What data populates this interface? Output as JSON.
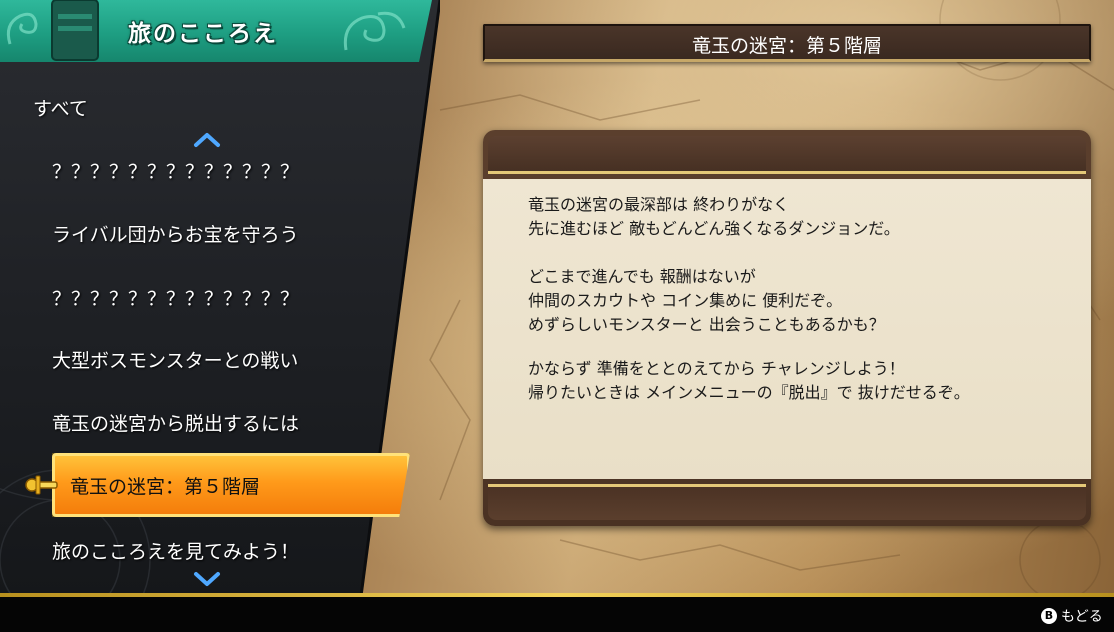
{
  "header": {
    "title": "旅のこころえ"
  },
  "menu": {
    "all_label": "すべて",
    "items": [
      "？？？？？？？？？？？？？",
      "ライバル団からお宝を守ろう",
      "？？？？？？？？？？？？？",
      "大型ボスモンスターとの戦い",
      "竜玉の迷宮から脱出するには",
      "竜玉の迷宮：第５階層",
      "旅のこころえを見てみよう！"
    ],
    "selected_index": 5
  },
  "content": {
    "title": "竜玉の迷宮：第５階層",
    "lines": [
      "竜玉の迷宮の最深部は 終わりがなく",
      "先に進むほど 敵もどんどん強くなるダンジョンだ。",
      "",
      "どこまで進んでも 報酬はないが",
      "仲間のスカウトや コイン集めに 便利だぞ。",
      "めずらしいモンスターと 出会うこともあるかも？",
      "",
      "かならず 準備をととのえてから チャレンジしよう！",
      "帰りたいときは メインメニューの『脱出』で 抜けだせるぞ。"
    ]
  },
  "footer": {
    "back_button_icon": "B",
    "back_label": "もどる"
  },
  "colors": {
    "header_green": "#1e9e82",
    "selected_orange": "#ff9a1a",
    "panel_dark": "#1d1f23",
    "parchment": "#efe6d2"
  }
}
